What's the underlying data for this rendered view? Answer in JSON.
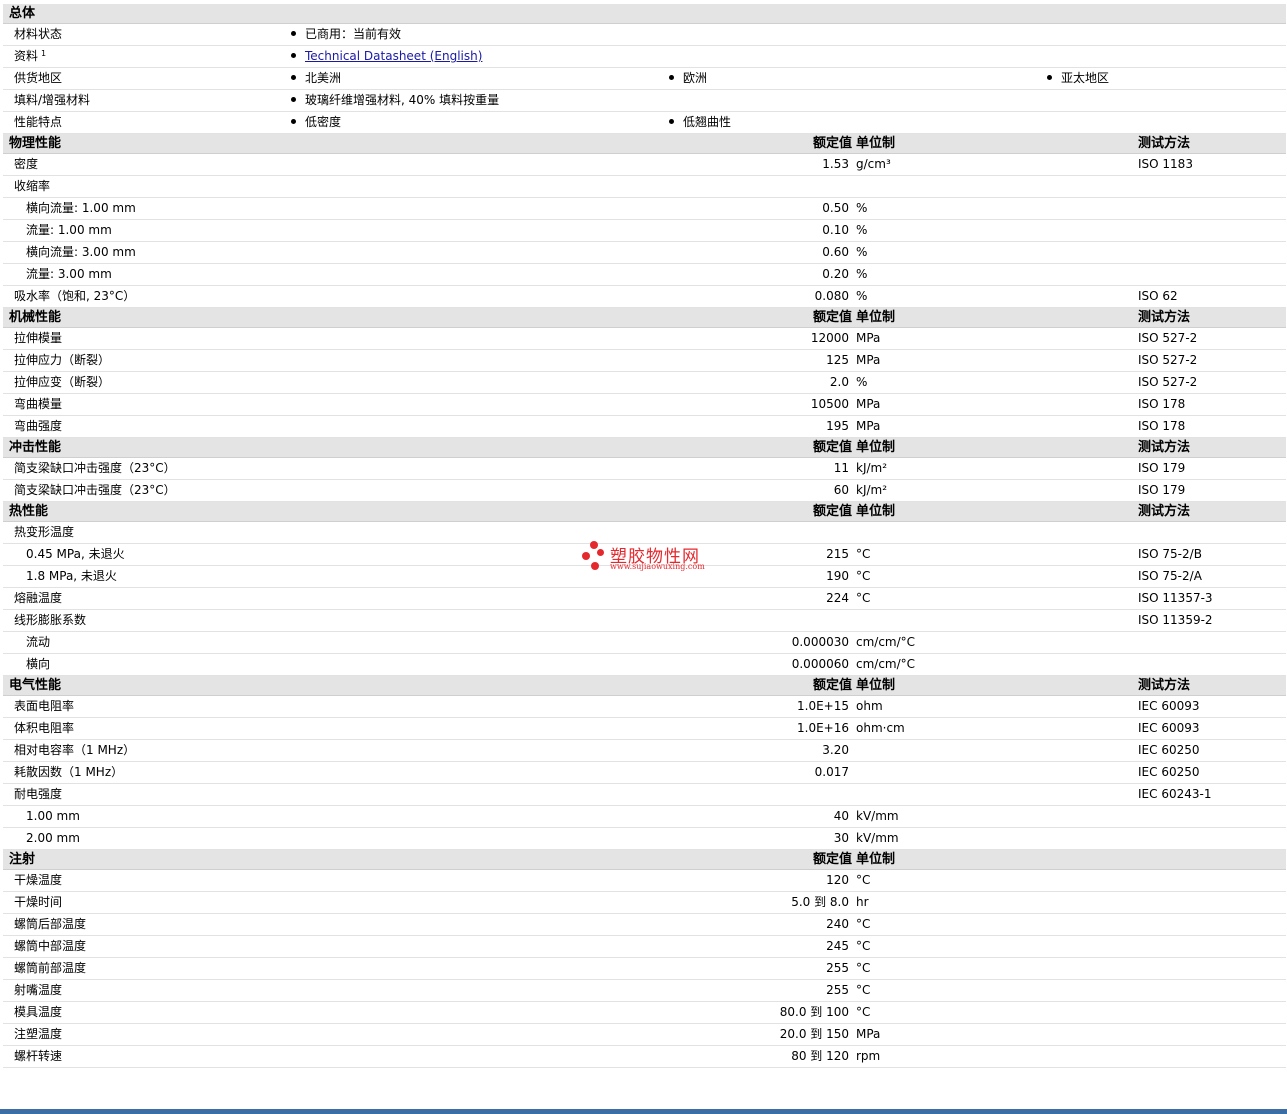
{
  "general": {
    "title": "总体",
    "rows": [
      {
        "label": "材料状态",
        "items": [
          "已商用：当前有效"
        ]
      },
      {
        "label": "资料",
        "sup": "1",
        "link": "Technical Datasheet (English)"
      },
      {
        "label": "供货地区",
        "items": [
          "北美洲",
          "欧洲",
          "亚太地区"
        ]
      },
      {
        "label": "填料/增强材料",
        "items": [
          "玻璃纤维增强材料, 40% 填料按重量"
        ]
      },
      {
        "label": "性能特点",
        "items": [
          "低密度",
          "低翘曲性"
        ]
      }
    ]
  },
  "columns": {
    "value": "额定值",
    "unit": "单位制",
    "method": "测试方法"
  },
  "sections": [
    {
      "title": "物理性能",
      "show_method": true,
      "rows": [
        {
          "label": "密度",
          "value": "1.53",
          "unit": "g/cm³",
          "method": "ISO 1183"
        },
        {
          "label": "收缩率"
        },
        {
          "label": "横向流量: 1.00 mm",
          "sub": true,
          "value": "0.50",
          "unit": "%"
        },
        {
          "label": "流量: 1.00 mm",
          "sub": true,
          "value": "0.10",
          "unit": "%"
        },
        {
          "label": "横向流量: 3.00 mm",
          "sub": true,
          "value": "0.60",
          "unit": "%"
        },
        {
          "label": "流量: 3.00 mm",
          "sub": true,
          "value": "0.20",
          "unit": "%"
        },
        {
          "label": "吸水率（饱和, 23°C）",
          "value": "0.080",
          "unit": "%",
          "method": "ISO 62"
        }
      ]
    },
    {
      "title": "机械性能",
      "show_method": true,
      "rows": [
        {
          "label": "拉伸模量",
          "value": "12000",
          "unit": "MPa",
          "method": "ISO 527-2"
        },
        {
          "label": "拉伸应力（断裂）",
          "value": "125",
          "unit": "MPa",
          "method": "ISO 527-2"
        },
        {
          "label": "拉伸应变（断裂）",
          "value": "2.0",
          "unit": "%",
          "method": "ISO 527-2"
        },
        {
          "label": "弯曲模量",
          "value": "10500",
          "unit": "MPa",
          "method": "ISO 178"
        },
        {
          "label": "弯曲强度",
          "value": "195",
          "unit": "MPa",
          "method": "ISO 178"
        }
      ]
    },
    {
      "title": "冲击性能",
      "show_method": true,
      "rows": [
        {
          "label": "简支梁缺口冲击强度（23°C）",
          "value": "11",
          "unit": "kJ/m²",
          "method": "ISO 179"
        },
        {
          "label": "简支梁缺口冲击强度（23°C）",
          "value": "60",
          "unit": "kJ/m²",
          "method": "ISO 179"
        }
      ]
    },
    {
      "title": "热性能",
      "show_method": true,
      "rows": [
        {
          "label": "热变形温度"
        },
        {
          "label": "0.45 MPa, 未退火",
          "sub": true,
          "value": "215",
          "unit": "°C",
          "method": "ISO 75-2/B"
        },
        {
          "label": "1.8 MPa, 未退火",
          "sub": true,
          "value": "190",
          "unit": "°C",
          "method": "ISO 75-2/A"
        },
        {
          "label": "熔融温度",
          "value": "224",
          "unit": "°C",
          "method": "ISO 11357-3"
        },
        {
          "label": "线形膨胀系数",
          "method": "ISO 11359-2"
        },
        {
          "label": "流动",
          "sub": true,
          "value": "0.000030",
          "unit": "cm/cm/°C"
        },
        {
          "label": "横向",
          "sub": true,
          "value": "0.000060",
          "unit": "cm/cm/°C"
        }
      ]
    },
    {
      "title": "电气性能",
      "show_method": true,
      "rows": [
        {
          "label": "表面电阻率",
          "value": "1.0E+15",
          "unit": "ohm",
          "method": "IEC 60093"
        },
        {
          "label": "体积电阻率",
          "value": "1.0E+16",
          "unit": "ohm·cm",
          "method": "IEC 60093"
        },
        {
          "label": "相对电容率（1 MHz）",
          "value": "3.20",
          "method": "IEC 60250"
        },
        {
          "label": "耗散因数（1 MHz）",
          "value": "0.017",
          "method": "IEC 60250"
        },
        {
          "label": "耐电强度",
          "method": "IEC 60243-1"
        },
        {
          "label": "1.00 mm",
          "sub": true,
          "value": "40",
          "unit": "kV/mm"
        },
        {
          "label": "2.00 mm",
          "sub": true,
          "value": "30",
          "unit": "kV/mm"
        }
      ]
    },
    {
      "title": "注射",
      "show_method": false,
      "rows": [
        {
          "label": "干燥温度",
          "value": "120",
          "unit": "°C"
        },
        {
          "label": "干燥时间",
          "value": "5.0 到  8.0",
          "unit": "hr"
        },
        {
          "label": "螺筒后部温度",
          "value": "240",
          "unit": "°C"
        },
        {
          "label": "螺筒中部温度",
          "value": "245",
          "unit": "°C"
        },
        {
          "label": "螺筒前部温度",
          "value": "255",
          "unit": "°C"
        },
        {
          "label": "射嘴温度",
          "value": "255",
          "unit": "°C"
        },
        {
          "label": "模具温度",
          "value": "80.0 到  100",
          "unit": "°C"
        },
        {
          "label": "注塑温度",
          "value": "20.0 到  150",
          "unit": "MPa"
        },
        {
          "label": "螺杆转速",
          "value": "80 到  120",
          "unit": "rpm"
        }
      ]
    }
  ],
  "watermark": {
    "title": "塑胶物性网",
    "url": "www.sujiaowuxing.com",
    "color": "#e4292e"
  },
  "colors": {
    "header_bg": "#e4e4e4",
    "link": "#1a1aa6",
    "bottom_bar": "#3a6ea5"
  }
}
